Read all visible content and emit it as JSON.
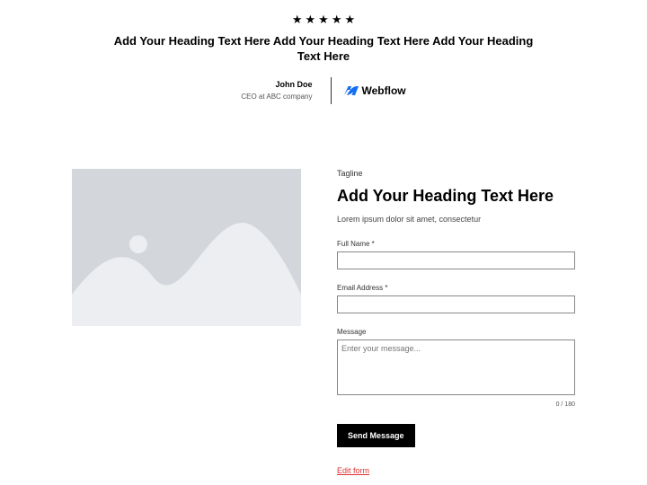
{
  "testimonial": {
    "stars": 5,
    "heading": "Add Your Heading Text Here Add Your Heading Text Here Add Your Heading Text Here",
    "name": "John Doe",
    "role": "CEO at ABC company",
    "logo_text": "Webflow"
  },
  "contact": {
    "tagline": "Tagline",
    "heading": "Add Your Heading Text Here",
    "subheading": "Lorem ipsum dolor sit amet, consectetur",
    "fields": {
      "fullname_label": "Full Name *",
      "email_label": "Email Address *",
      "message_label": "Message",
      "message_placeholder": "Enter your message...",
      "counter": "0 / 180"
    },
    "submit_label": "Send Message",
    "edit_link": "Edit form"
  }
}
